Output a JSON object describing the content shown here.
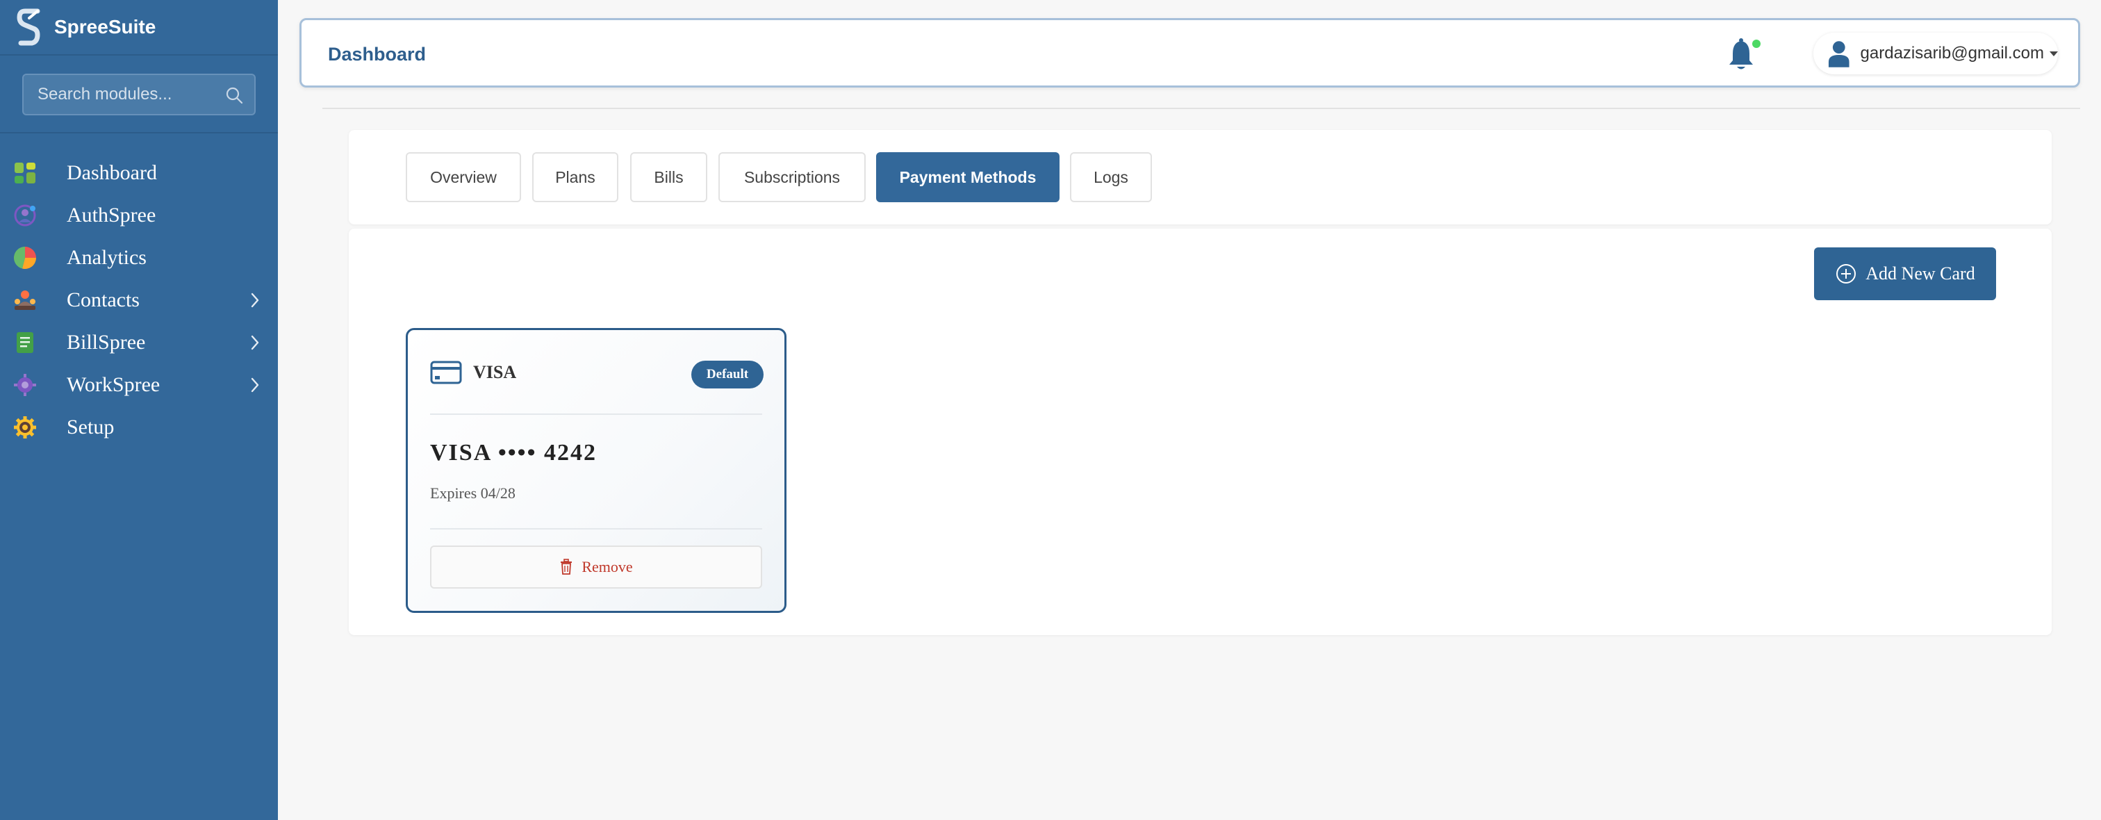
{
  "app": {
    "name": "SpreeSuite"
  },
  "sidebar": {
    "search_placeholder": "Search modules...",
    "items": [
      {
        "label": "Dashboard",
        "icon": "dashboard-icon",
        "has_children": false
      },
      {
        "label": "AuthSpree",
        "icon": "authspree-icon",
        "has_children": false
      },
      {
        "label": "Analytics",
        "icon": "analytics-pie-icon",
        "has_children": false
      },
      {
        "label": "Contacts",
        "icon": "contacts-icon",
        "has_children": true
      },
      {
        "label": "BillSpree",
        "icon": "billspree-icon",
        "has_children": true
      },
      {
        "label": "WorkSpree",
        "icon": "workspree-icon",
        "has_children": true
      },
      {
        "label": "Setup",
        "icon": "setup-gear-icon",
        "has_children": false
      }
    ]
  },
  "header": {
    "title": "Dashboard",
    "user_email": "gardazisarib@gmail.com",
    "notification_status_color": "#4cd964"
  },
  "tabs": [
    {
      "label": "Overview",
      "active": false
    },
    {
      "label": "Plans",
      "active": false
    },
    {
      "label": "Bills",
      "active": false
    },
    {
      "label": "Subscriptions",
      "active": false
    },
    {
      "label": "Payment Methods",
      "active": true
    },
    {
      "label": "Logs",
      "active": false
    }
  ],
  "actions": {
    "add_card_label": "Add New Card"
  },
  "cards": [
    {
      "brand": "VISA",
      "badge": "Default",
      "number": "VISA •••• 4242",
      "expiry": "Expires 04/28",
      "remove_label": "Remove"
    }
  ],
  "colors": {
    "primary": "#33689a",
    "danger": "#c0392b"
  }
}
